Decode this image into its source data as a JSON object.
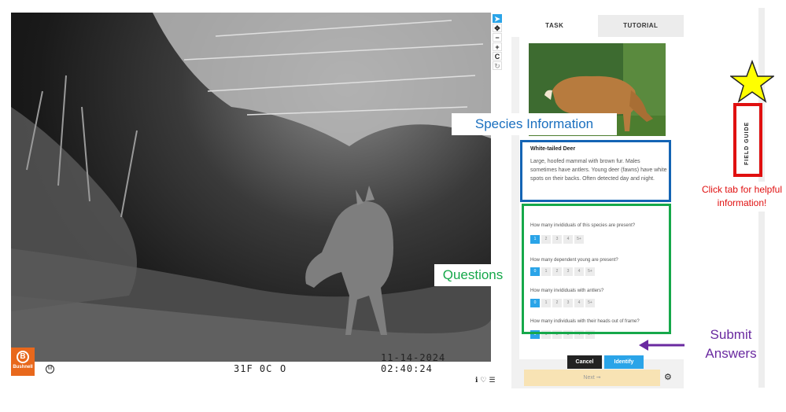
{
  "camera": {
    "temperature": "31F 0C",
    "moon_symbol": "O",
    "datetime": "11-14-2024  02:40:24",
    "brand": "Bushnell",
    "brand_initial": "B",
    "mode_symbol": "M"
  },
  "toolbar": {
    "tools": [
      {
        "name": "pointer-icon",
        "glyph": "➤"
      },
      {
        "name": "move-icon",
        "glyph": "✥"
      },
      {
        "name": "zoom-out-icon",
        "glyph": "−"
      },
      {
        "name": "zoom-in-icon",
        "glyph": "+"
      },
      {
        "name": "reset-icon",
        "glyph": "C"
      },
      {
        "name": "rotate-icon",
        "glyph": "↻"
      }
    ]
  },
  "meta_icons": {
    "info": "ℹ",
    "favorite": "♡",
    "collect": "☰"
  },
  "tabs": {
    "task": "TASK",
    "tutorial": "TUTORIAL"
  },
  "species": {
    "name": "White-tailed Deer",
    "description": "Large, hoofed mammal with brown fur. Males sometimes have antlers. Young deer (fawns) have white spots on their backs. Often detected day and night."
  },
  "questions": [
    {
      "text": "How many invididuals of this species are present?",
      "options": [
        "1",
        "2",
        "3",
        "4",
        "5+"
      ],
      "selected": 0
    },
    {
      "text": "How many dependent young are present?",
      "options": [
        "0",
        "1",
        "2",
        "3",
        "4",
        "5+"
      ],
      "selected": 0
    },
    {
      "text": "How many invididuals with antlers?",
      "options": [
        "0",
        "1",
        "2",
        "3",
        "4",
        "5+"
      ],
      "selected": 0
    },
    {
      "text": "How many individuals with their heads out of frame?",
      "options": [
        "0",
        "1",
        "2",
        "3",
        "4",
        "5+"
      ],
      "selected": 0
    }
  ],
  "buttons": {
    "cancel": "Cancel",
    "identify": "Identify",
    "next": "Next ➞"
  },
  "field_guide": {
    "label": "FIELD GUIDE"
  },
  "annotations": {
    "species_info": "Species Information",
    "questions": "Questions",
    "submit": "Submit Answers",
    "field_tip": "Click tab for helpful information!"
  },
  "colors": {
    "accent": "#2aa4e8",
    "annotation_blue": "#1464b4",
    "annotation_green": "#16a84a",
    "annotation_red": "#e01010",
    "annotation_purple": "#6a2aa0",
    "star_yellow": "#ffff00"
  }
}
